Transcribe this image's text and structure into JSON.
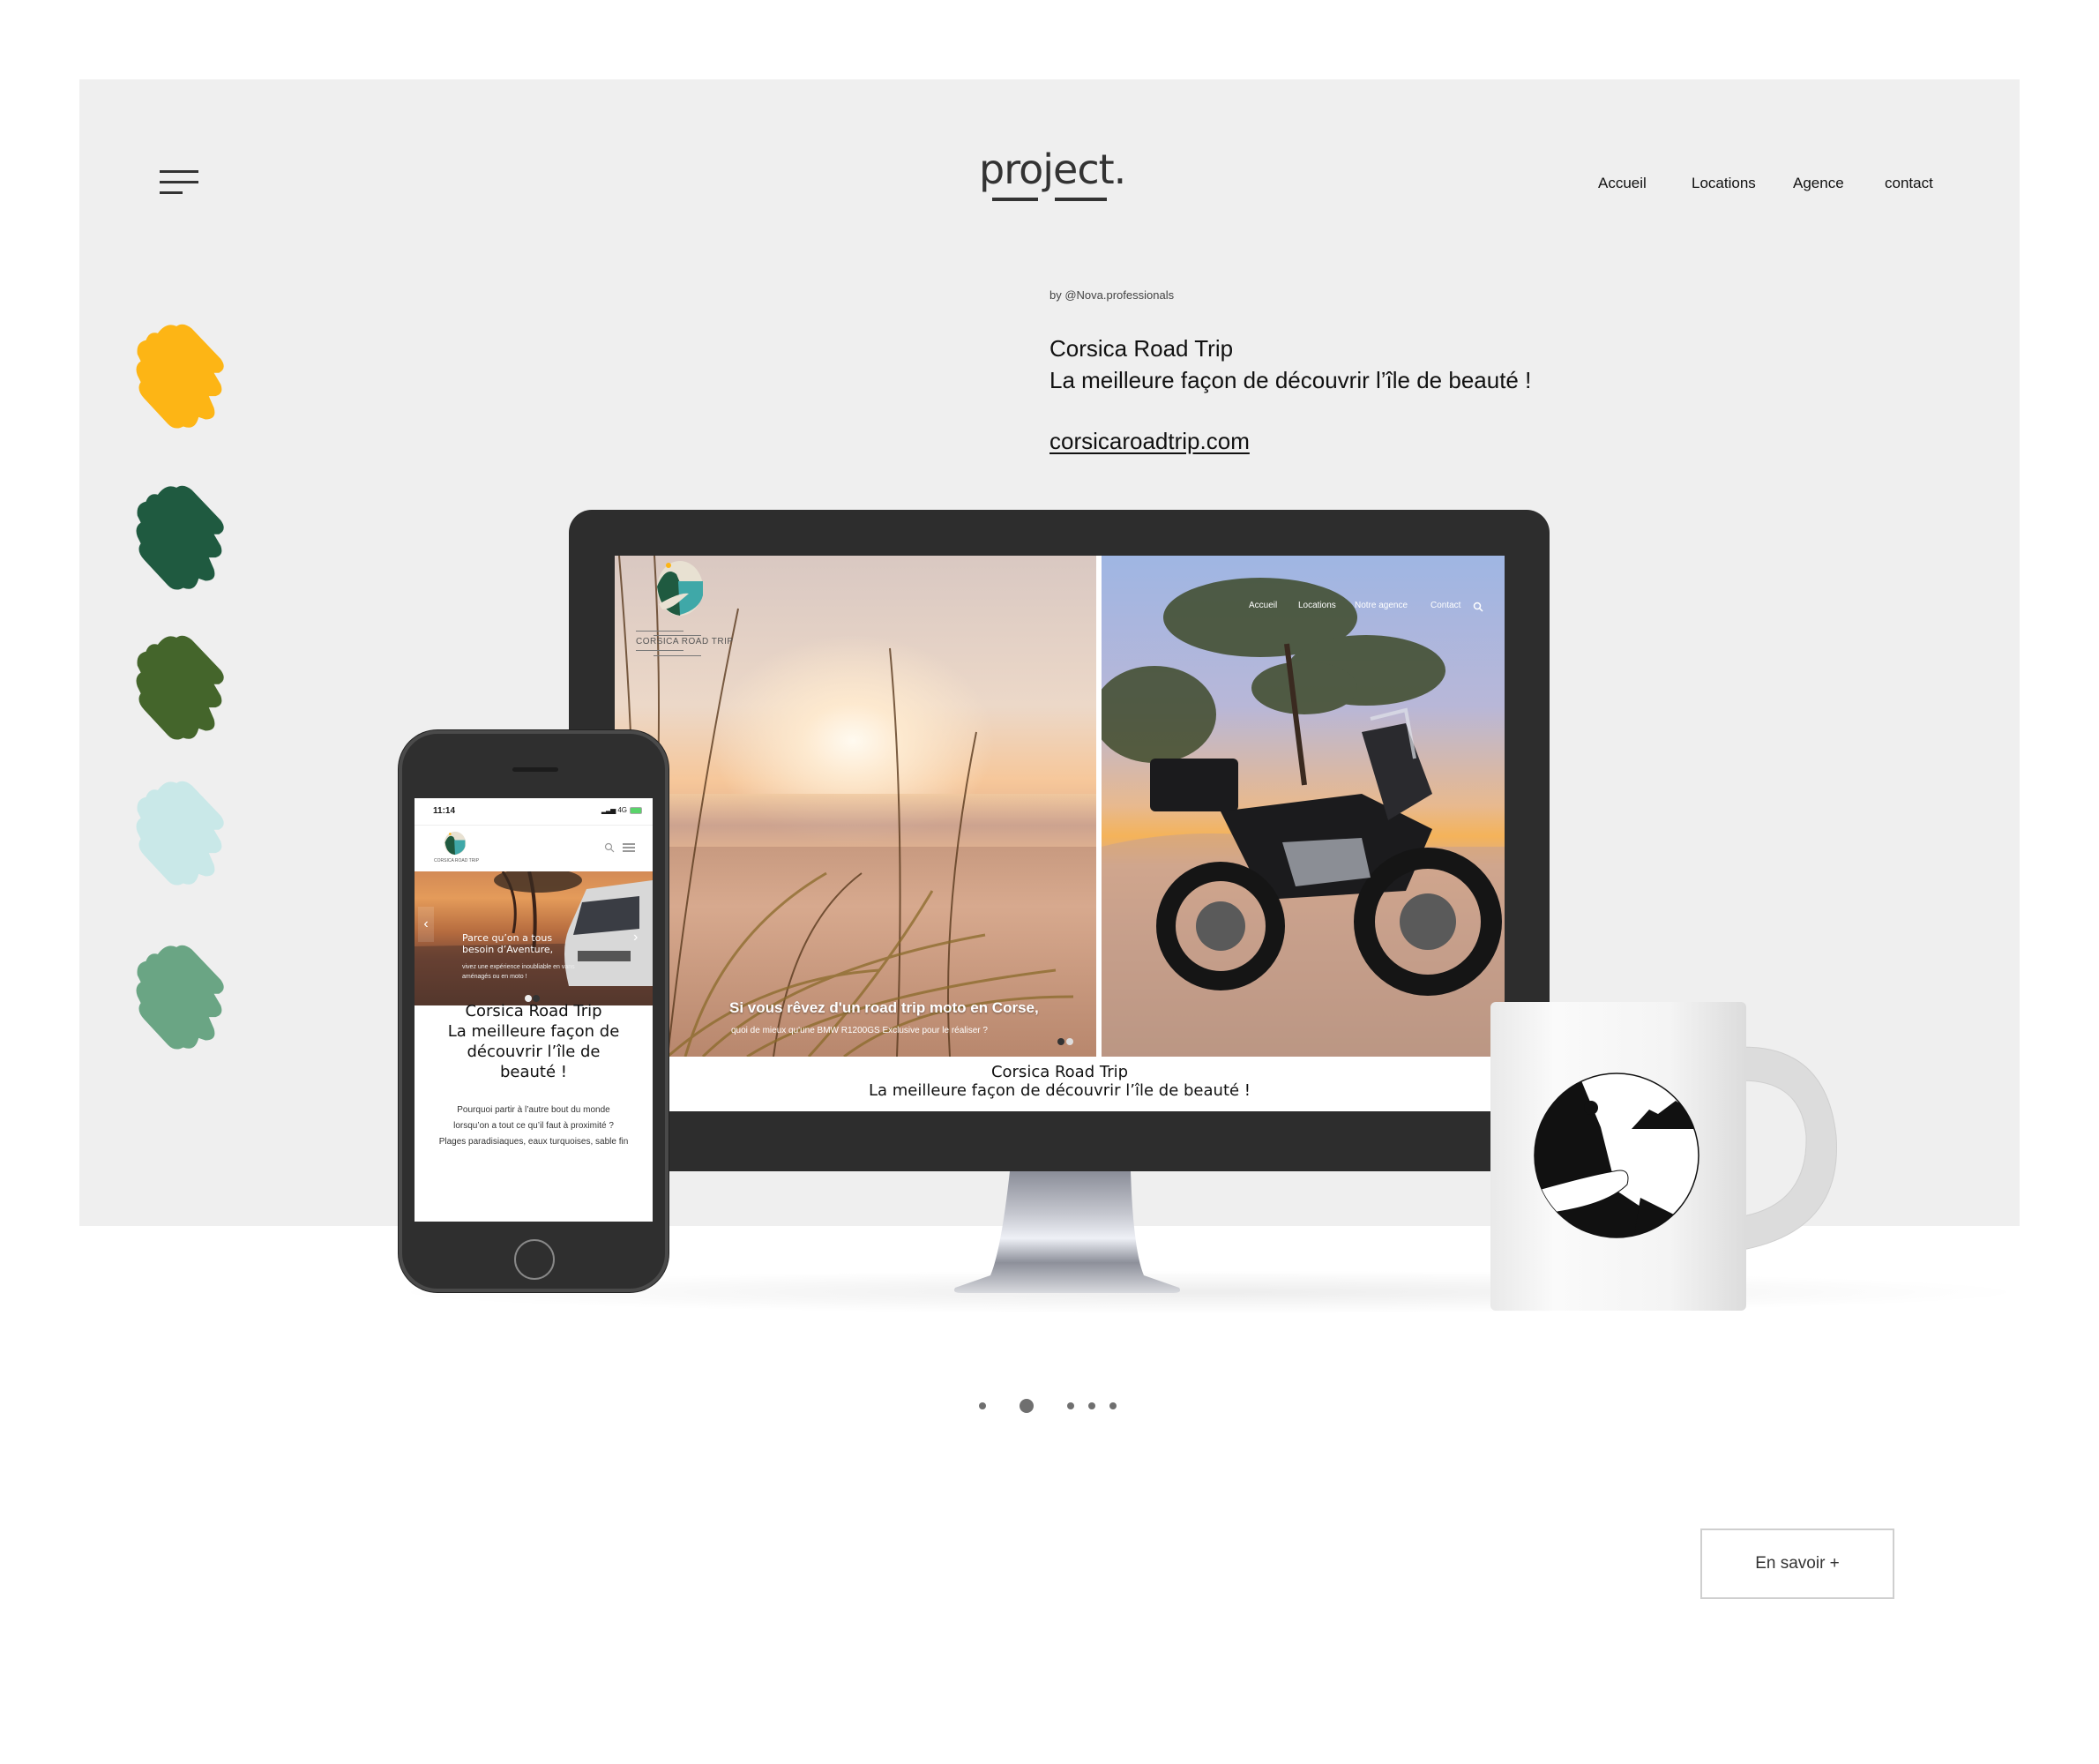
{
  "header": {
    "brand": "project.",
    "nav": [
      {
        "label": "Accueil"
      },
      {
        "label": "Locations"
      },
      {
        "label": "Agence"
      },
      {
        "label": "contact"
      }
    ]
  },
  "intro": {
    "byline": "by @Nova.professionals",
    "title_line1": "Corsica Road Trip",
    "title_line2": "La meilleure façon de découvrir l’île de beauté !",
    "link": "corsicaroadtrip.com"
  },
  "palette": [
    {
      "name": "yellow",
      "color": "#fdb515"
    },
    {
      "name": "dark-green",
      "color": "#1f5a40"
    },
    {
      "name": "olive-green",
      "color": "#44652b"
    },
    {
      "name": "pale-aqua",
      "color": "#c9e8e8"
    },
    {
      "name": "sage-green",
      "color": "#6aa584"
    }
  ],
  "desktop_mockup": {
    "logo_text": "CORSICA ROAD TRIP",
    "nav": [
      {
        "label": "Accueil"
      },
      {
        "label": "Locations"
      },
      {
        "label": "Notre agence"
      },
      {
        "label": "Contact"
      }
    ],
    "hero_caption": "Si vous rêvez d'un road trip moto en Corse,",
    "hero_subcaption": "quoi de mieux qu'une BMW R1200GS Exclusive pour le réaliser ?",
    "next_arrow": "›",
    "title_line1": "Corsica Road Trip",
    "title_line2": "La meilleure façon de découvrir l’île de beauté !"
  },
  "mobile_mockup": {
    "time": "11:14",
    "network": "4G",
    "logo_text": "CORSICA ROAD TRIP",
    "hero_title_line1": "Parce qu’on a tous",
    "hero_title_line2": "besoin d’Aventure,",
    "hero_sub_line1": "vivez une expérience inoubliable en vans",
    "hero_sub_line2": "aménagés ou en moto !",
    "prev_arrow": "‹",
    "next_arrow": "›",
    "title_line1": "Corsica Road Trip",
    "title_line2": "La meilleure façon de",
    "title_line3": "découvrir l’île de",
    "title_line4": "beauté !",
    "body_line1": "Pourquoi partir à l’autre bout du monde",
    "body_line2": "lorsqu’on a tout ce qu’il faut à proximité ?",
    "body_line3": "Plages paradisiaques, eaux turquoises, sable fin"
  },
  "pager": {
    "count": 5,
    "active_index": 1
  },
  "cta": {
    "label": "En savoir +"
  }
}
